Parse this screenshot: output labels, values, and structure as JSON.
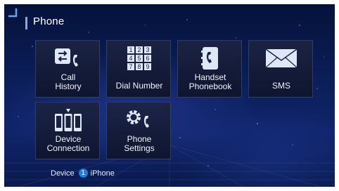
{
  "header": {
    "title": "Phone"
  },
  "tiles": [
    {
      "name": "call-history",
      "line1": "Call",
      "line2": "History"
    },
    {
      "name": "dial-number",
      "label": "Dial Number",
      "keys": [
        "1",
        "2",
        "3",
        "4",
        "5",
        "6",
        "7",
        "8",
        "9"
      ]
    },
    {
      "name": "handset-phonebook",
      "line1": "Handset",
      "line2": "Phonebook"
    },
    {
      "name": "sms",
      "label": "SMS"
    },
    {
      "name": "device-connection",
      "line1": "Device",
      "line2": "Connection"
    },
    {
      "name": "phone-settings",
      "line1": "Phone",
      "line2": "Settings"
    }
  ],
  "status": {
    "device_label": "Device",
    "device_number": "1",
    "device_name": "iPhone"
  },
  "colors": {
    "accent": "#1c7fe0",
    "background": "#0b1f5c",
    "tile": "#1a2242"
  },
  "icons": [
    "swap-arrows-phone-icon",
    "keypad-icon",
    "phonebook-icon",
    "envelope-icon",
    "devices-icon",
    "gear-phone-icon"
  ]
}
